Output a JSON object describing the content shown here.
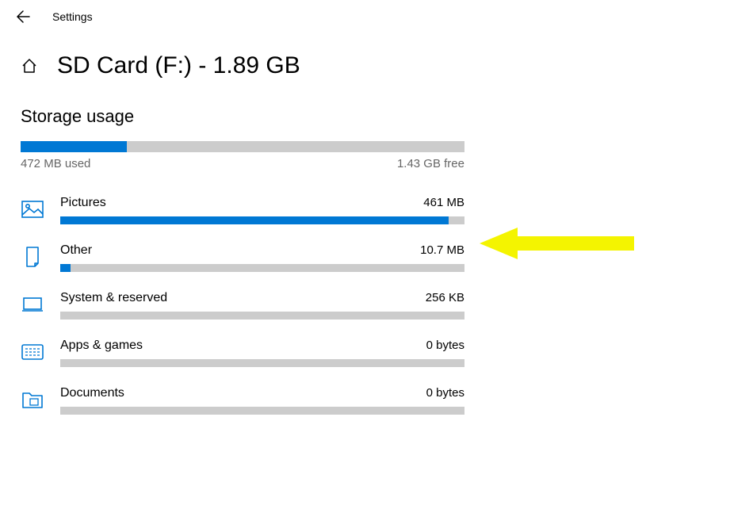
{
  "topbar": {
    "settings_label": "Settings"
  },
  "header": {
    "title": "SD Card (F:) - 1.89 GB"
  },
  "section": {
    "title": "Storage usage"
  },
  "overall": {
    "used_label": "472 MB used",
    "free_label": "1.43 GB free",
    "fill_percent": 24
  },
  "categories": [
    {
      "icon": "pictures-icon",
      "name": "Pictures",
      "size": "461 MB",
      "fill_percent": 96
    },
    {
      "icon": "other-icon",
      "name": "Other",
      "size": "10.7 MB",
      "fill_percent": 2.5
    },
    {
      "icon": "system-icon",
      "name": "System & reserved",
      "size": "256 KB",
      "fill_percent": 0
    },
    {
      "icon": "apps-icon",
      "name": "Apps & games",
      "size": "0 bytes",
      "fill_percent": 0
    },
    {
      "icon": "documents-icon",
      "name": "Documents",
      "size": "0 bytes",
      "fill_percent": 0
    }
  ]
}
